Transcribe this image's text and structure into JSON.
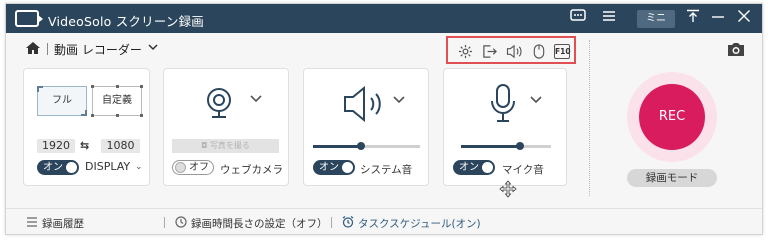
{
  "titlebar": {
    "app_title": "VideoSolo スクリーン録画",
    "mini_label": "ミニ",
    "icons": [
      "feedback-icon",
      "menu-icon",
      "pin-icon",
      "minimize-icon",
      "close-icon"
    ],
    "bg_color": "#2b465c"
  },
  "subheader": {
    "mode_label": "動画 レコーダー",
    "toolbar_icons": [
      "settings-icon",
      "export-icon",
      "volume-icon",
      "mouse-icon",
      "f10-hotkey-icon"
    ],
    "f10_label": "F10",
    "highlight_color": "#e05052"
  },
  "display_panel": {
    "full_label": "フル",
    "custom_label": "自定義",
    "width": "1920",
    "height": "1080",
    "toggle_label": "オン",
    "source_label": "DISPLAY"
  },
  "webcam_panel": {
    "photo_button_label": "写真を撮る",
    "toggle_label": "オフ",
    "source_label": "ウェブカメラ"
  },
  "system_audio_panel": {
    "toggle_label": "オン",
    "source_label": "システム音",
    "volume": 0.45
  },
  "mic_panel": {
    "toggle_label": "オン",
    "source_label": "マイク音",
    "volume": 0.65
  },
  "record": {
    "rec_label": "REC",
    "mode_label": "録画モード",
    "accent_color": "#d81c5e"
  },
  "footer": {
    "history_label": "録画履歴",
    "duration_label": "録画時間長さの設定（オフ）",
    "schedule_label": "タスクスケジュール(オン)"
  }
}
